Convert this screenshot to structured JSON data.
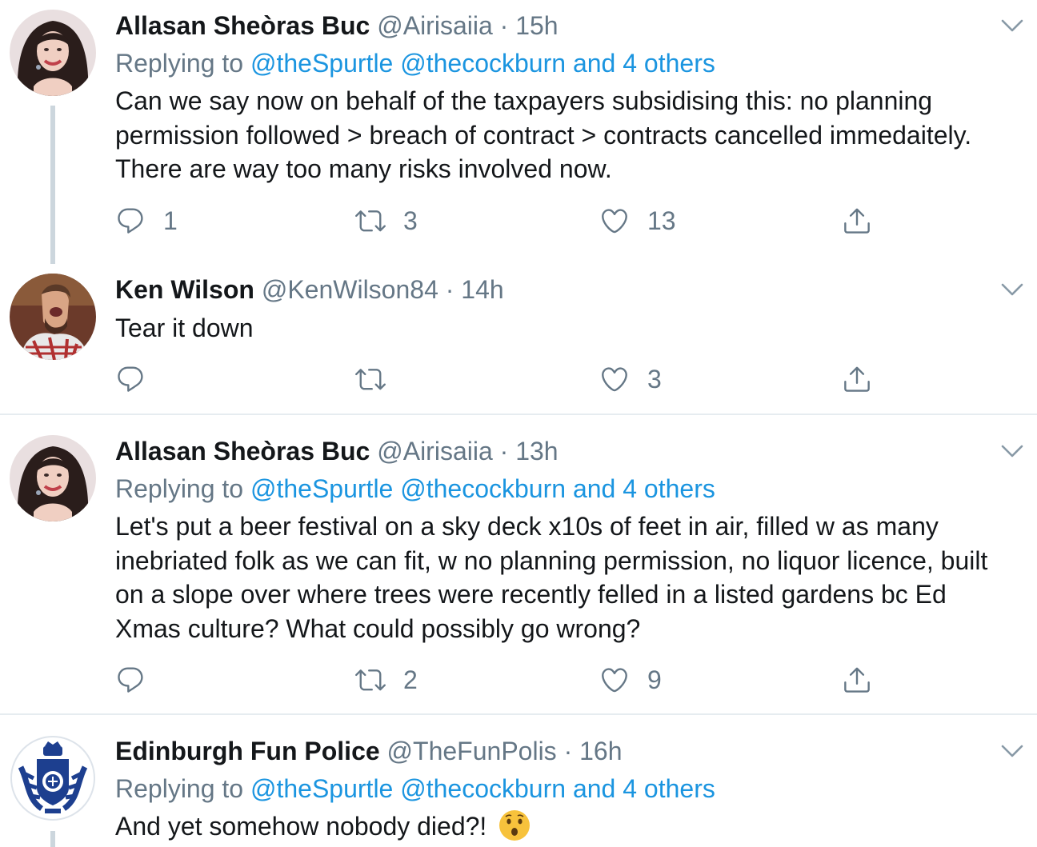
{
  "tweets": [
    {
      "name": "Allasan Sheòras Buc",
      "handle": "@Airisaiia",
      "dot": "·",
      "time": "15h",
      "reply_prefix": "Replying to",
      "reply_mentions": "@theSpurtle @thecockburn and 4 others",
      "text": "Can we say now on behalf of the taxpayers subsidising this: no planning permission followed > breach of contract > contracts cancelled immedaitely. There are way too many risks involved now.",
      "reply_count": "1",
      "retweet_count": "3",
      "like_count": "13"
    },
    {
      "name": "Ken Wilson",
      "handle": "@KenWilson84",
      "dot": "·",
      "time": "14h",
      "text": "Tear it down",
      "reply_count": "",
      "retweet_count": "",
      "like_count": "3"
    },
    {
      "name": "Allasan Sheòras Buc",
      "handle": "@Airisaiia",
      "dot": "·",
      "time": "13h",
      "reply_prefix": "Replying to",
      "reply_mentions": "@theSpurtle @thecockburn and 4 others",
      "text": "Let's put a beer festival on a sky deck x10s of feet in air, filled w as many inebriated folk as we can fit, w no planning permission, no liquor licence, built on a slope over where trees were recently felled in a listed gardens bc Ed Xmas culture? What could possibly go wrong?",
      "reply_count": "",
      "retweet_count": "2",
      "like_count": "9"
    },
    {
      "name": "Edinburgh Fun Police",
      "handle": "@TheFunPolis",
      "dot": "·",
      "time": "16h",
      "reply_prefix": "Replying to",
      "reply_mentions": "@theSpurtle @thecockburn and 4 others",
      "text": "And yet somehow nobody died?!",
      "emoji": "hushed-face-emoji"
    }
  ],
  "icons": {
    "reply": "reply-icon",
    "retweet": "retweet-icon",
    "like": "heart-icon",
    "share": "share-icon",
    "more": "chevron-down-icon"
  },
  "colors": {
    "link": "#1b95e0",
    "secondary": "#657786",
    "thread_line": "#ccd6dd",
    "divider": "#e6ecf0"
  }
}
